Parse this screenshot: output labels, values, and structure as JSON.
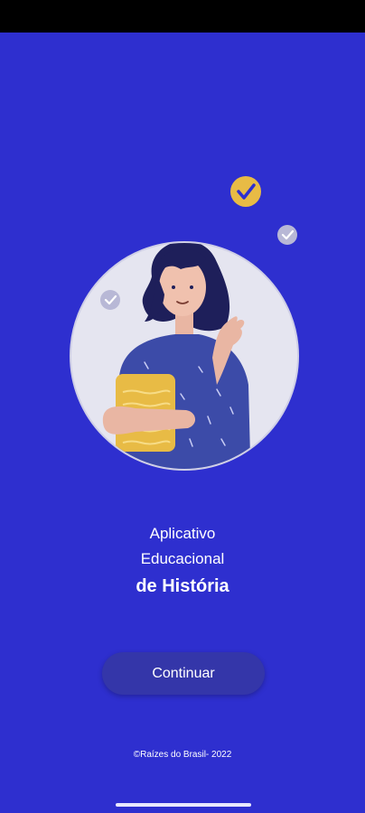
{
  "title": {
    "line1": "Aplicativo",
    "line2": "Educacional",
    "line3": "de História"
  },
  "continue_button": {
    "label": "Continuar"
  },
  "footer": {
    "text": "©Raízes do Brasil-  2022"
  },
  "colors": {
    "background": "#2e2fcf",
    "button": "#3436a9",
    "accent_yellow": "#e8bb45",
    "shirt": "#3c4ba8",
    "circle": "#e5e5f0"
  },
  "icons": {
    "check_large": "check-badge-icon",
    "check_small": "check-small-icon"
  }
}
